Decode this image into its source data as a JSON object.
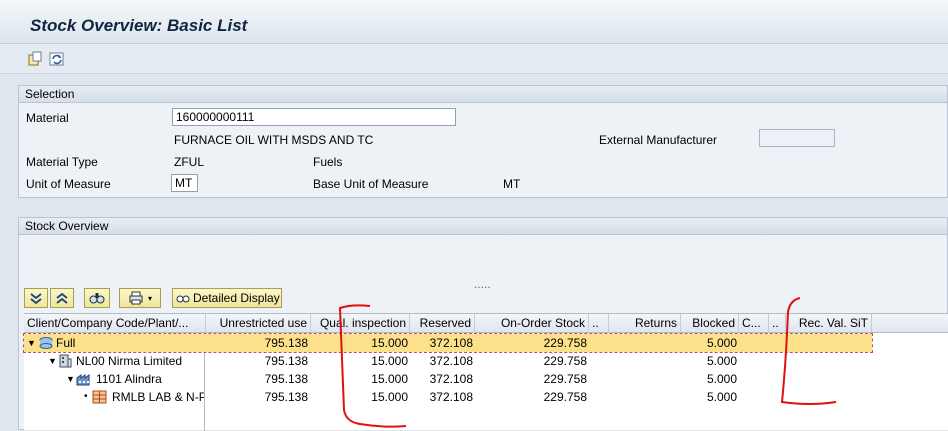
{
  "app": {
    "title": "Stock Overview: Basic List"
  },
  "toolbar": {
    "icons": [
      "new-session-icon",
      "refresh-icon"
    ]
  },
  "selection": {
    "header": "Selection",
    "material_label": "Material",
    "material_value": "160000000111",
    "material_desc": "FURNACE OIL WITH MSDS AND TC",
    "external_manufacturer_label": "External Manufacturer",
    "external_manufacturer_value": "",
    "material_type_label": "Material Type",
    "material_type_value": "ZFUL",
    "material_type_desc": "Fuels",
    "uom_label": "Unit of Measure",
    "uom_value": "MT",
    "base_uom_label": "Base Unit of Measure",
    "base_uom_value": "MT"
  },
  "stock_overview": {
    "header": "Stock Overview",
    "divider": "....."
  },
  "grid_toolbar": {
    "detailed_display_label": "Detailed Display"
  },
  "grid": {
    "columns": [
      "Client/Company Code/Plant/...",
      "Unrestricted use",
      "Qual. inspection",
      "Reserved",
      "On-Order Stock",
      "..",
      "Returns",
      "Blocked",
      "C...",
      "..",
      "Rec. Val. SiT"
    ],
    "rows": [
      {
        "name": "Full",
        "unrestricted": "795.138",
        "qual": "15.000",
        "reserved": "372.108",
        "onorder": "229.758",
        "blocked": "5.000"
      },
      {
        "name": "NL00 Nirma Limited",
        "unrestricted": "795.138",
        "qual": "15.000",
        "reserved": "372.108",
        "onorder": "229.758",
        "blocked": "5.000"
      },
      {
        "name": "1101 Alindra",
        "unrestricted": "795.138",
        "qual": "15.000",
        "reserved": "372.108",
        "onorder": "229.758",
        "blocked": "5.000"
      },
      {
        "name": "RMLB LAB & N-P",
        "unrestricted": "795.138",
        "qual": "15.000",
        "reserved": "372.108",
        "onorder": "229.758",
        "blocked": "5.000"
      }
    ]
  },
  "colors": {
    "accent": "#10253f",
    "selected_row": "#fce08a",
    "annotation_red": "#e01010"
  }
}
